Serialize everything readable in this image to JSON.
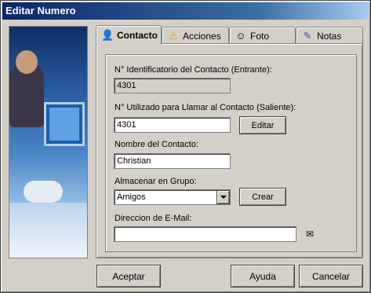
{
  "window": {
    "title": "Editar Numero"
  },
  "tabs": [
    {
      "label": "Contacto",
      "icon": "person-icon",
      "active": true
    },
    {
      "label": "Acciones",
      "icon": "warning-icon",
      "active": false
    },
    {
      "label": "Foto",
      "icon": "face-icon",
      "active": false
    },
    {
      "label": "Notas",
      "icon": "pencil-icon",
      "active": false
    }
  ],
  "form": {
    "incoming_id_label": "N° Identificatorio del Contacto (Entrante):",
    "incoming_id_value": "4301",
    "outgoing_number_label": "N° Utilizado para Llamar al Contacto (Saliente):",
    "outgoing_number_value": "4301",
    "edit_button": "Editar",
    "contact_name_label": "Nombre del Contacto:",
    "contact_name_value": "Christian",
    "group_label": "Almacenar en Grupo:",
    "group_value": "Amigos",
    "create_button": "Crear",
    "email_label": "Direccion de E-Mail:",
    "email_value": ""
  },
  "footer": {
    "accept_button": "Aceptar",
    "help_button": "Ayuda",
    "cancel_button": "Cancelar"
  }
}
